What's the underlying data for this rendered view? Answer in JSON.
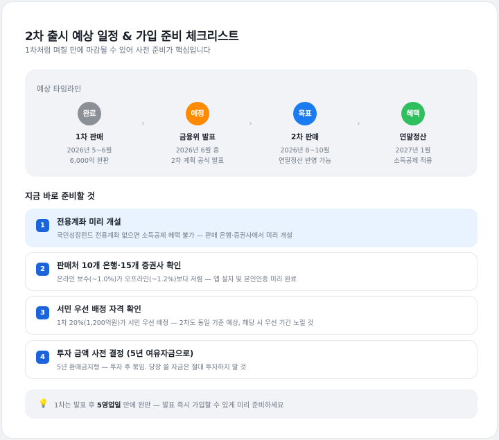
{
  "header": {
    "title": "2차 출시 예상 일정 & 가입 준비 체크리스트",
    "subtitle": "1차처럼 며칠 만에 마감될 수 있어 사전 준비가 핵심입니다"
  },
  "timeline": {
    "label": "예상 타임라인",
    "steps": [
      {
        "badge": "완료",
        "title": "1차 판매",
        "line1": "2026년 5~6월",
        "line2": "6,000억 완판",
        "color": "#8b8f96"
      },
      {
        "badge": "예정",
        "title": "금융위 발표",
        "line1": "2026년 6월 중",
        "line2": "2차 계획 공식 발표",
        "color": "#ff8a00"
      },
      {
        "badge": "목표",
        "title": "2차 판매",
        "line1": "2026년 8~10월",
        "line2": "연말정산 반영 가능",
        "color": "#1b7cf2"
      },
      {
        "badge": "혜택",
        "title": "연말정산",
        "line1": "2027년 1월",
        "line2": "소득공제 적용",
        "color": "#2fbf5f"
      }
    ],
    "separator": "›"
  },
  "checklist": {
    "title": "지금 바로 준비할 것",
    "items": [
      {
        "num": "1",
        "title": "전용계좌 미리 개설",
        "desc": "국민성장펀드 전용계좌 없으면 소득공제 혜택 불가 — 판매 은행·증권사에서 미리 개설"
      },
      {
        "num": "2",
        "title": "판매처 10개 은행·15개 증권사 확인",
        "desc": "온라인 보수(~1.0%)가 오프라인(~1.2%)보다 저렴 — 앱 설치 및 본인인증 미리 완료"
      },
      {
        "num": "3",
        "title": "서민 우선 배정 자격 확인",
        "desc": "1차 20%(1,200억원)가 서민 우선 배정 — 2차도 동일 기준 예상, 해당 시 우선 기간 노릴 것"
      },
      {
        "num": "4",
        "title": "투자 금액 사전 결정 (5년 여유자금으로)",
        "desc": "5년 환매금지형 — 투자 후 묶임. 당장 쓸 자금은 절대 투자하지 말 것"
      }
    ]
  },
  "tip": {
    "icon": "lightbulb-icon",
    "prefix": "1차는 발표 후 ",
    "bold": "5영업일",
    "suffix": " 만에 완판 — 발표 즉시 가입할 수 있게 미리 준비하세요"
  },
  "colors": {
    "accent": "#1b64da",
    "active_bg": "#e8f3ff",
    "panel_bg": "#f2f3f6"
  }
}
